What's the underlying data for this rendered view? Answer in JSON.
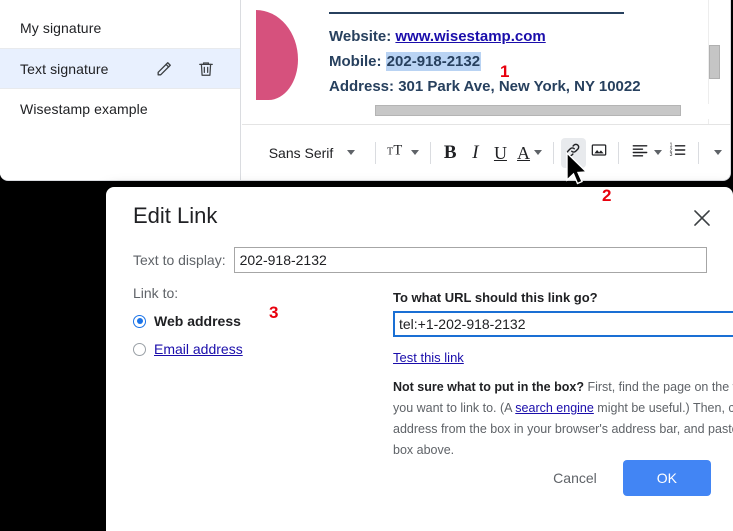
{
  "signature_list": {
    "items": [
      {
        "label": "My signature",
        "selected": false
      },
      {
        "label": "Text signature",
        "selected": true
      },
      {
        "label": "Wisestamp example",
        "selected": false
      }
    ],
    "edit_icon": "pencil-icon",
    "delete_icon": "trash-icon"
  },
  "preview": {
    "website_label": "Website:",
    "website_value": "www.wisestamp.com",
    "mobile_label": "Mobile:",
    "mobile_value": "202-918-2132",
    "address_label": "Address:",
    "address_value": "301 Park Ave, New York, NY 10022",
    "selection_color": "#b9d3f3",
    "accent_color": "#27405e",
    "mark_color": "#d6517d"
  },
  "toolbar": {
    "font_name": "Sans Serif",
    "size_icon": "font-size-icon",
    "bold_label": "B",
    "italic_label": "I",
    "underline_label": "U",
    "text_color_label": "A",
    "link_icon": "link-icon",
    "image_icon": "insert-image-icon",
    "align_icon": "align-left-icon",
    "list_icon": "numbered-list-icon",
    "more_icon": "more-options-icon"
  },
  "dialog": {
    "title": "Edit Link",
    "close_icon": "close-icon",
    "text_to_display_label": "Text to display:",
    "text_to_display_value": "202-918-2132",
    "link_to_label": "Link to:",
    "radio_web_label": "Web address",
    "radio_email_label": "Email address",
    "url_question": "To what URL should this link go?",
    "url_value": "tel:+1-202-918-2132",
    "test_link_label": "Test this link",
    "help_bold": "Not sure what to put in the box?",
    "help_part1": " First, find the page on the web that you want to link to. (A ",
    "help_link": "search engine",
    "help_part2": " might be useful.) Then, copy the web address from the box in your browser's address bar, and paste it into the box above.",
    "cancel_label": "Cancel",
    "ok_label": "OK",
    "ok_color": "#4285f4"
  },
  "annotations": {
    "step1": "1",
    "step2": "2",
    "step3": "3",
    "color": "#e8000d"
  }
}
